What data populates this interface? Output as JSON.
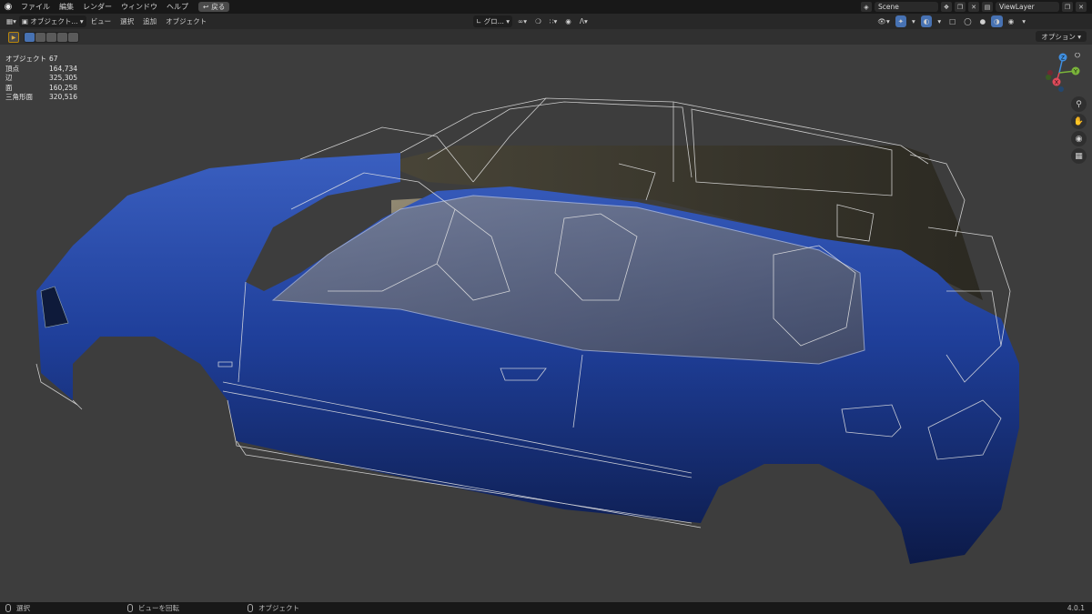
{
  "topbar": {
    "logo_icon": "blender-logo-icon",
    "menus": [
      "ファイル",
      "編集",
      "レンダー",
      "ウィンドウ",
      "ヘルプ"
    ],
    "back_label": "戻る",
    "scene_name": "Scene",
    "view_layer": "ViewLayer"
  },
  "header": {
    "mode": "オブジェクト...",
    "menus": [
      "ビュー",
      "選択",
      "追加",
      "オブジェクト"
    ],
    "transform_orientation": "グロ..."
  },
  "toolbar": {
    "options_label": "オプション"
  },
  "stats": [
    {
      "label": "オブジェクト",
      "value": "67"
    },
    {
      "label": "頂点",
      "value": "164,734"
    },
    {
      "label": "辺",
      "value": "325,305"
    },
    {
      "label": "面",
      "value": "160,258"
    },
    {
      "label": "三角形面",
      "value": "320,516"
    }
  ],
  "gizmo": {
    "axes": [
      "Z",
      "Y",
      "X"
    ],
    "colors": {
      "x": "#e04a5a",
      "y": "#7ab43a",
      "z": "#3f8fe0"
    }
  },
  "statusbar": {
    "select": "選択",
    "rotate": "ビューを回転",
    "object": "オブジェクト",
    "version": "4.0.1"
  },
  "colors": {
    "accent": "#4772b3",
    "car_body": "#1f3f9a",
    "interior": "#8a806a"
  }
}
